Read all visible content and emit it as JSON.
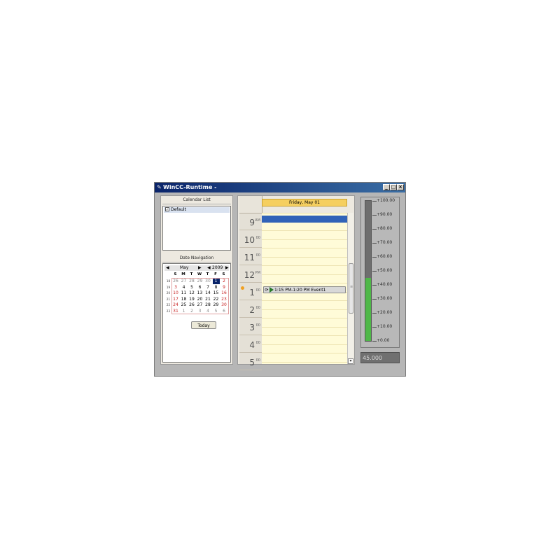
{
  "window": {
    "title": "WinCC-Runtime -",
    "controls": [
      "_",
      "□",
      "×"
    ]
  },
  "calendar_list": {
    "header": "Calendar List",
    "items": [
      {
        "label": "Default",
        "checked": true
      }
    ]
  },
  "date_navigation": {
    "header": "Date Navigation",
    "month": "May",
    "year": "2009",
    "weekday_labels": [
      "S",
      "M",
      "T",
      "W",
      "T",
      "F",
      "S"
    ],
    "week_numbers": [
      "18",
      "19",
      "20",
      "21",
      "22",
      "23"
    ],
    "weeks": [
      [
        "26",
        "27",
        "28",
        "29",
        "30",
        "1",
        "2"
      ],
      [
        "3",
        "4",
        "5",
        "6",
        "7",
        "8",
        "9"
      ],
      [
        "10",
        "11",
        "12",
        "13",
        "14",
        "15",
        "16"
      ],
      [
        "17",
        "18",
        "19",
        "20",
        "21",
        "22",
        "23"
      ],
      [
        "24",
        "25",
        "26",
        "27",
        "28",
        "29",
        "30"
      ],
      [
        "31",
        "1",
        "2",
        "3",
        "4",
        "5",
        "6"
      ]
    ],
    "selected_day": "1",
    "today_button": "Today"
  },
  "day_view": {
    "date_header": "Friday, May 01",
    "hours": [
      {
        "h": "9",
        "m": "AM"
      },
      {
        "h": "10",
        "m": "00"
      },
      {
        "h": "11",
        "m": "00"
      },
      {
        "h": "12",
        "m": "PM"
      },
      {
        "h": "1",
        "m": "00"
      },
      {
        "h": "2",
        "m": "00"
      },
      {
        "h": "3",
        "m": "00"
      },
      {
        "h": "4",
        "m": "00"
      },
      {
        "h": "5",
        "m": "00"
      }
    ],
    "event": {
      "text": "1:15 PM-1:20 PM Event1"
    }
  },
  "gauge": {
    "scale_labels": [
      "+100.00",
      "+90.00",
      "+80.00",
      "+70.00",
      "+60.00",
      "+50.00",
      "+40.00",
      "+30.00",
      "+20.00",
      "+10.00",
      "+0.00"
    ],
    "min": 0,
    "max": 100,
    "value": 45,
    "readout": "45.000",
    "fill_color": "#4fb848"
  }
}
